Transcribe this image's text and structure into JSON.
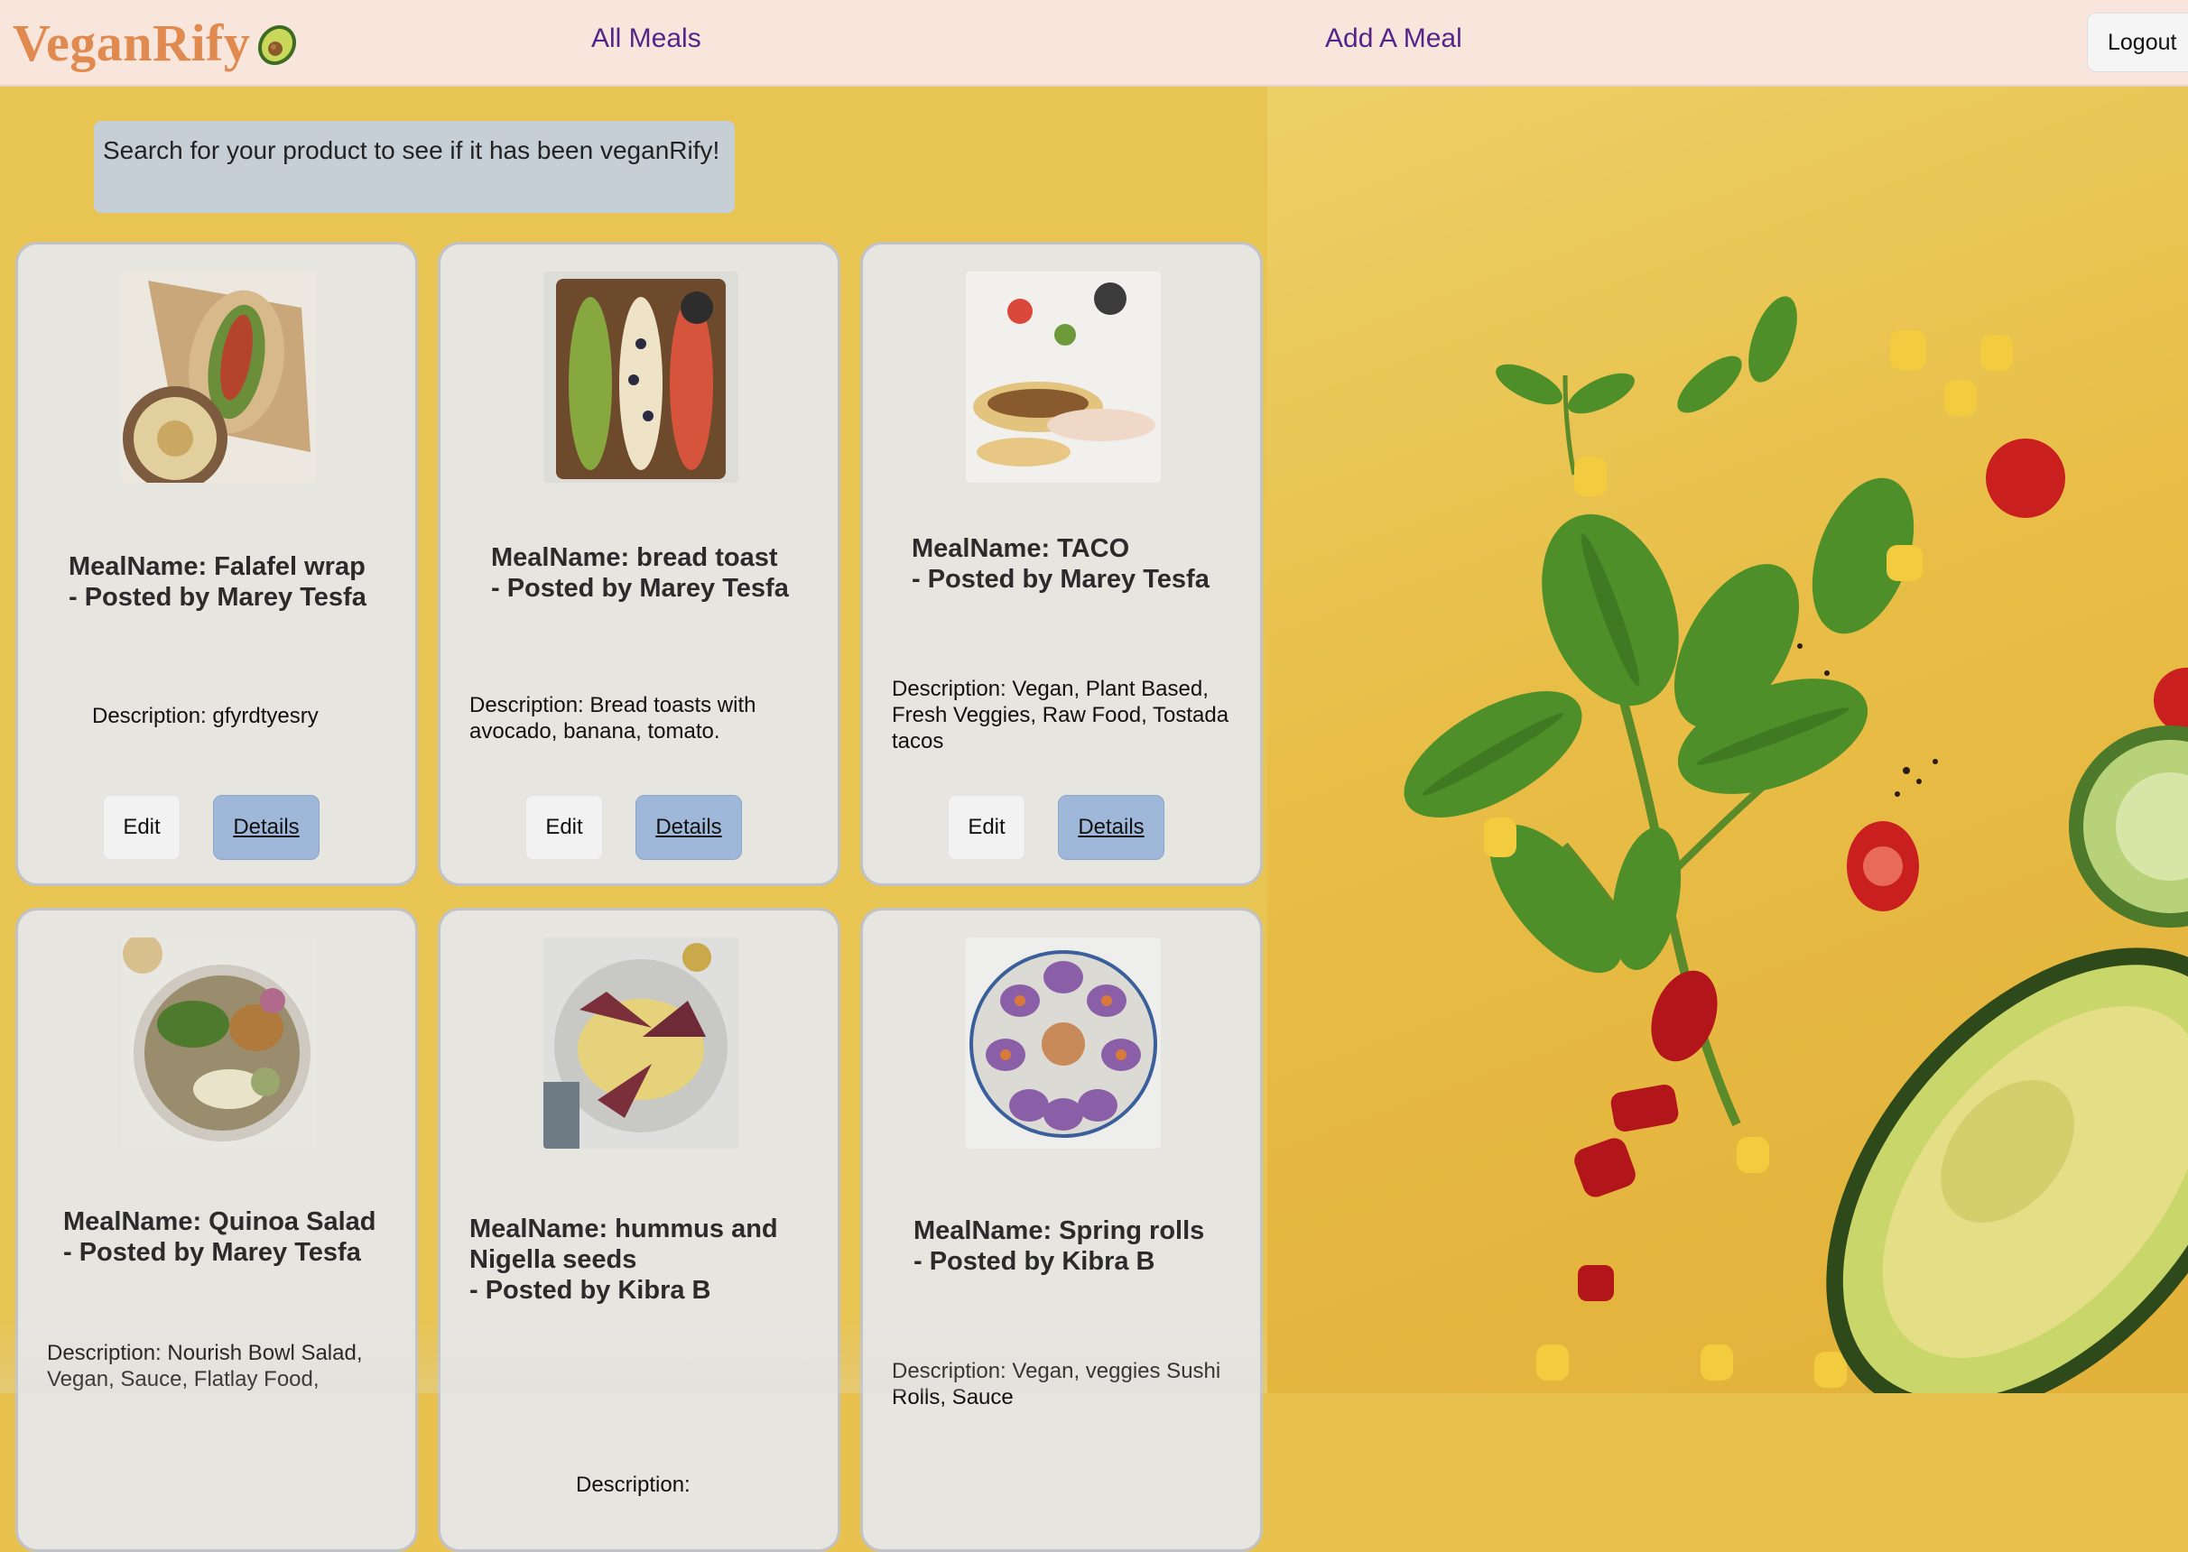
{
  "brand": {
    "name": "VeganRify"
  },
  "nav": {
    "all_meals": "All Meals",
    "add_meal": "Add A Meal",
    "logout": "Logout"
  },
  "search": {
    "text": "Search for your product to see if it has been veganRify!"
  },
  "meals": [
    {
      "title": "MealName: Falafel wrap",
      "poster": "- Posted by Marey Tesfa",
      "description": "Description: gfyrdtyesry",
      "edit": "Edit",
      "details": "Details"
    },
    {
      "title": "MealName: bread toast",
      "poster": "- Posted by Marey Tesfa",
      "description": "Description: Bread toasts with avocado, banana, tomato.",
      "edit": "Edit",
      "details": "Details"
    },
    {
      "title": "MealName: TACO",
      "poster": "- Posted by Marey Tesfa",
      "description": "Description: Vegan, Plant Based, Fresh Veggies, Raw Food, Tostada tacos",
      "edit": "Edit",
      "details": "Details"
    },
    {
      "title": "MealName: Quinoa Salad",
      "poster": "- Posted by Marey Tesfa",
      "description": "Description: Nourish Bowl Salad, Vegan, Sauce, Flatlay Food,"
    },
    {
      "title": "MealName: hummus and Nigella seeds",
      "poster": "- Posted by Kibra B",
      "description": "Description:"
    },
    {
      "title": "MealName: Spring rolls",
      "poster": "- Posted by Kibra B",
      "description": "Description: Vegan, veggies Sushi Rolls, Sauce"
    }
  ],
  "colors": {
    "navbar_bg": "#f8e6dc",
    "brand": "#e08a4f",
    "nav_link": "#54248a",
    "page_bg": "#e8c453",
    "card_bg": "#e6e5e0",
    "details_btn": "#9fb7d9"
  },
  "icons": {
    "brand_icon": "avocado-icon"
  }
}
